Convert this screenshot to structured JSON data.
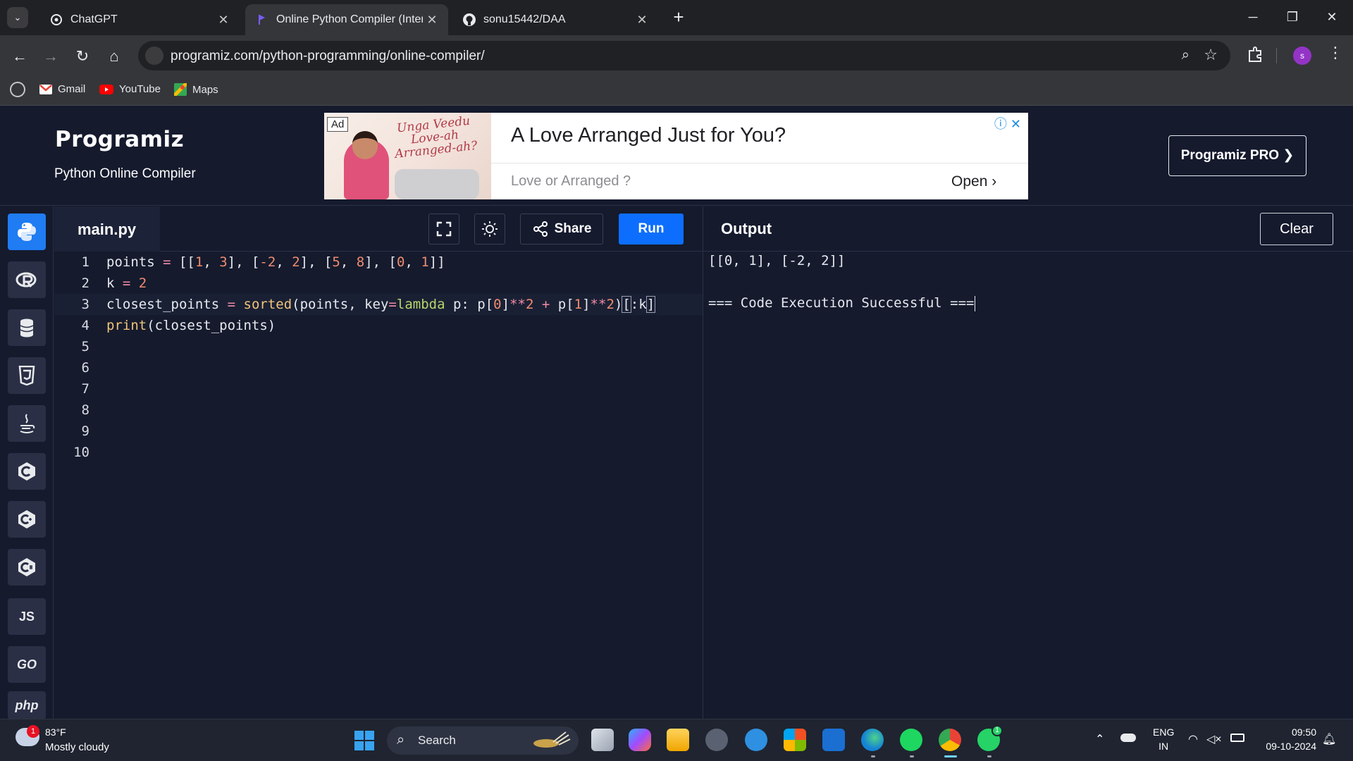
{
  "browser": {
    "tabs": [
      {
        "title": "ChatGPT",
        "icon": "chatgpt-icon",
        "active": false
      },
      {
        "title": "Online Python Compiler (Interp",
        "icon": "programiz-icon",
        "active": true
      },
      {
        "title": "sonu15442/DAA",
        "icon": "github-icon",
        "active": false
      }
    ],
    "url": "programiz.com/python-programming/online-compiler/",
    "bookmarks": [
      "Gmail",
      "YouTube",
      "Maps"
    ],
    "profile_initial": "s"
  },
  "site": {
    "logo": "Programiz",
    "subtitle": "Python Online Compiler",
    "pro_button": "Programiz PRO ❯"
  },
  "ad": {
    "badge": "Ad",
    "script_text": "Unga Veedu Love-ah Arranged-ah?",
    "headline": "A Love Arranged Just for You?",
    "sub": "Love or Arranged ?",
    "cta": "Open"
  },
  "languages": [
    "python",
    "r",
    "sql",
    "html",
    "java",
    "c",
    "c++",
    "c#",
    "JS",
    "GO",
    "php"
  ],
  "editor": {
    "filename": "main.py",
    "share_label": "Share",
    "run_label": "Run",
    "line_numbers": [
      "1",
      "2",
      "3",
      "4",
      "5",
      "6",
      "7",
      "8",
      "9",
      "10"
    ],
    "code": [
      "points = [[1, 3], [-2, 2], [5, 8], [0, 1]]",
      "k = 2",
      "closest_points = sorted(points, key=lambda p: p[0]**2 + p[1]**2)[:k]",
      "print(closest_points)"
    ]
  },
  "output": {
    "title": "Output",
    "clear_label": "Clear",
    "lines": [
      "[[0, 1], [-2, 2]]",
      "",
      "=== Code Execution Successful ==="
    ]
  },
  "taskbar": {
    "weather_temp": "83°F",
    "weather_desc": "Mostly cloudy",
    "weather_badge": "1",
    "search_placeholder": "Search",
    "lang_top": "ENG",
    "lang_bottom": "IN",
    "time": "09:50",
    "date": "09-10-2024",
    "whatsapp_badge": "1"
  },
  "colors": {
    "run_button": "#0d6efd",
    "page_bg": "#151a2d",
    "active_lang": "#1f7cf2"
  }
}
